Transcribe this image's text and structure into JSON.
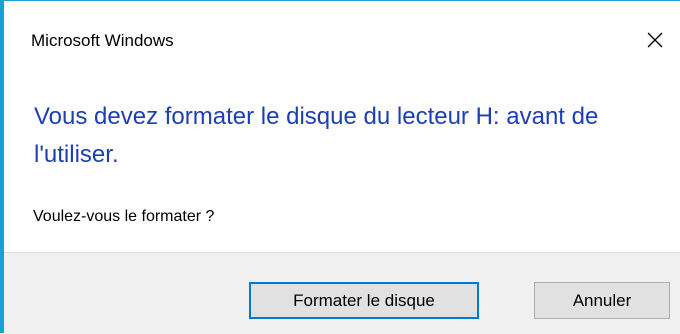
{
  "window": {
    "title": "Microsoft Windows",
    "close_icon": "close-icon"
  },
  "message": {
    "main_instruction": "Vous devez formater le disque du lecteur H: avant de l'utiliser.",
    "content": "Voulez-vous le formater ?"
  },
  "buttons": {
    "format_label": "Formater le disque",
    "cancel_label": "Annuler"
  },
  "colors": {
    "accent_border": "#19a0d8",
    "instruction_text": "#1d3fb4",
    "footer_background": "#f0f0f0",
    "default_button_border": "#0078d7"
  }
}
